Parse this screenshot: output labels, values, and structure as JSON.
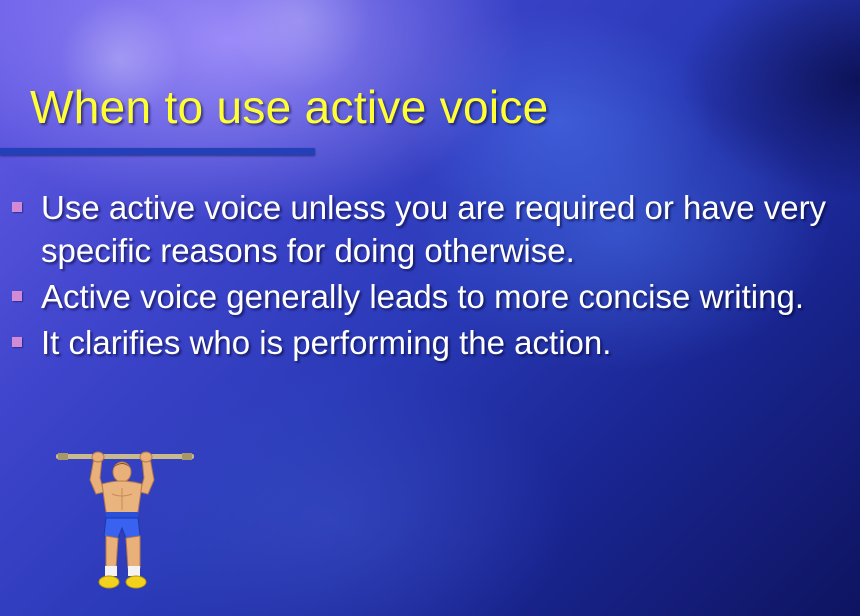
{
  "slide": {
    "title": "When to use active voice",
    "bullets": [
      {
        "text": "Use active voice unless you are required or have very specific reasons for doing otherwise."
      },
      {
        "text": "Active voice generally leads to more concise writing."
      },
      {
        "text": "It clarifies who is performing the action."
      }
    ],
    "illustration": {
      "icon": "weightlifter-icon"
    },
    "colors": {
      "title": "#ffff33",
      "text": "#ffffff",
      "bullet_marker": "#d08ad6",
      "title_rule": "#2440b8",
      "background": "#2a3ab8"
    }
  }
}
